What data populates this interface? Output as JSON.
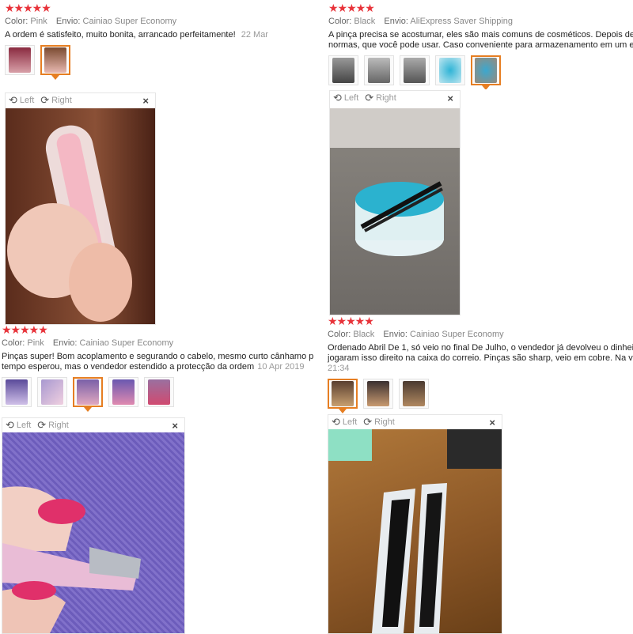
{
  "viewer_labels": {
    "left": "Left",
    "right": "Right",
    "close": "×"
  },
  "reviews": [
    {
      "stars": "★★★★★",
      "color_key": "Color:",
      "color_val": "Pink",
      "ship_key": "Envio:",
      "ship_val": "Cainiao Super Economy",
      "text": [
        "A ordem é satisfeito, muito bonita, arrancado perfeitamente!"
      ],
      "date": "22 Mar",
      "thumbs": [
        "#b04060",
        "#c08a70"
      ]
    },
    {
      "stars": "★★★★★",
      "color_key": "Color:",
      "color_val": "Black",
      "ship_key": "Envio:",
      "ship_val": "AliExpress Saver Shipping",
      "text": [
        "A pinça precisa se acostumar, eles são mais comuns de cosméticos. Depois de um",
        "normas, que você pode usar. Caso conveniente para armazenamento em um espa"
      ],
      "date": "",
      "thumbs": [
        "#777",
        "#999",
        "#888",
        "#3ab6d1",
        "#4aa8c8"
      ]
    },
    {
      "stars": "★★★★★",
      "color_key": "Color:",
      "color_val": "Pink",
      "ship_key": "Envio:",
      "ship_val": "Cainiao Super Economy",
      "text": [
        "Pinças super! Bom acoplamento e segurando o cabelo, mesmo curto cânhamo p",
        "tempo esperou, mas o vendedor estendido a protecção da ordem"
      ],
      "date": "10 Apr 2019",
      "thumbs": [
        "#6a5aa8",
        "#b8a8d8",
        "#8a70b0",
        "#7a68b8",
        "#a06090"
      ]
    },
    {
      "stars": "★★★★★",
      "color_key": "Color:",
      "color_val": "Black",
      "ship_key": "Envio:",
      "ship_val": "Cainiao Super Economy",
      "text": [
        "Ordenado Abril De 1, só veio no final De Julho, o vendedor já devolveu o dinheiro. T",
        "jogaram isso direito na caixa do correio. Pinças são sharp, veio em cobre. Na verda",
        "21:34"
      ],
      "date": "",
      "thumbs": [
        "#6a5030",
        "#a08060",
        "#8a7050"
      ]
    }
  ]
}
